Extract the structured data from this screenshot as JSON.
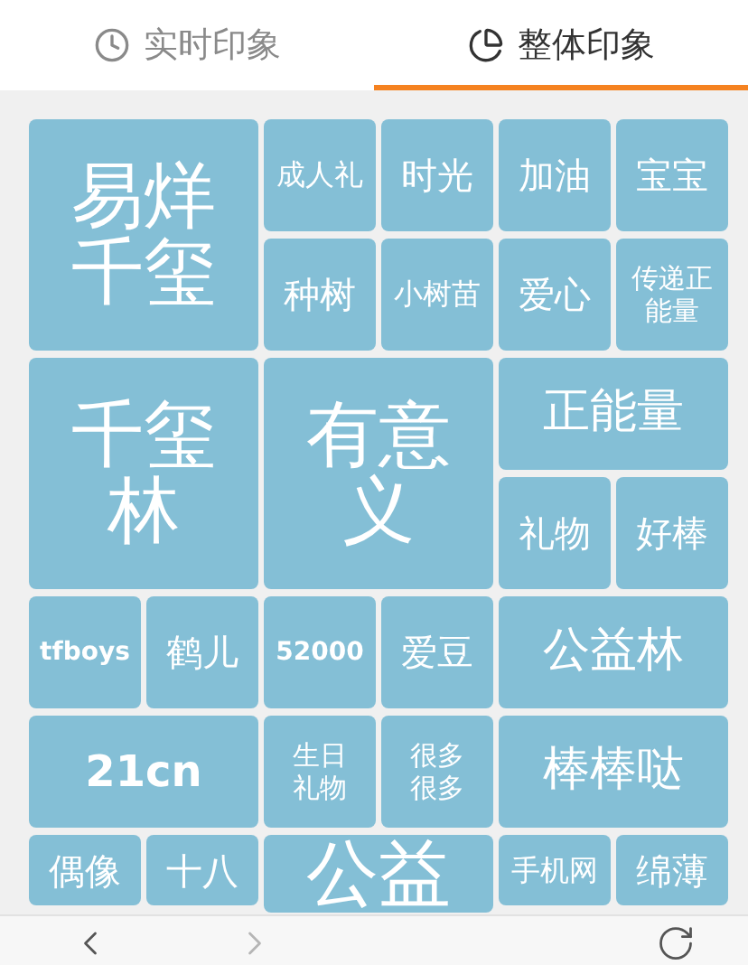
{
  "tabs": [
    {
      "label": "实时印象",
      "selected": false
    },
    {
      "label": "整体印象",
      "selected": true
    }
  ],
  "tiles": [
    {
      "text": "易烊千玺",
      "kind": "large"
    },
    {
      "text": "成人礼",
      "kind": "small"
    },
    {
      "text": "时光",
      "kind": "small"
    },
    {
      "text": "加油",
      "kind": "small"
    },
    {
      "text": "宝宝",
      "kind": "small"
    },
    {
      "text": "种树",
      "kind": "small"
    },
    {
      "text": "小树苗",
      "kind": "small"
    },
    {
      "text": "爱心",
      "kind": "small"
    },
    {
      "text": "传递正能量",
      "kind": "small"
    },
    {
      "text": "千玺林",
      "kind": "large"
    },
    {
      "text": "有意义",
      "kind": "large"
    },
    {
      "text": "正能量",
      "kind": "wide"
    },
    {
      "text": "礼物",
      "kind": "small"
    },
    {
      "text": "好棒",
      "kind": "small"
    },
    {
      "text": "tfboys",
      "kind": "small"
    },
    {
      "text": "鹤儿",
      "kind": "small"
    },
    {
      "text": "52000",
      "kind": "small"
    },
    {
      "text": "爱豆",
      "kind": "small"
    },
    {
      "text": "公益林",
      "kind": "wide"
    },
    {
      "text": "21cn",
      "kind": "wide"
    },
    {
      "text": "生日礼物",
      "kind": "small"
    },
    {
      "text": "很多很多",
      "kind": "small"
    },
    {
      "text": "棒棒哒",
      "kind": "wide"
    },
    {
      "text": "偶像",
      "kind": "small"
    },
    {
      "text": "十八",
      "kind": "small"
    },
    {
      "text": "公益",
      "kind": "large"
    },
    {
      "text": "手机网",
      "kind": "small"
    },
    {
      "text": "绵薄",
      "kind": "small"
    }
  ],
  "toolbar": [
    {
      "kind": "back",
      "disabled": false
    },
    {
      "kind": "forward",
      "disabled": true
    },
    {
      "kind": "refresh",
      "disabled": false
    }
  ]
}
